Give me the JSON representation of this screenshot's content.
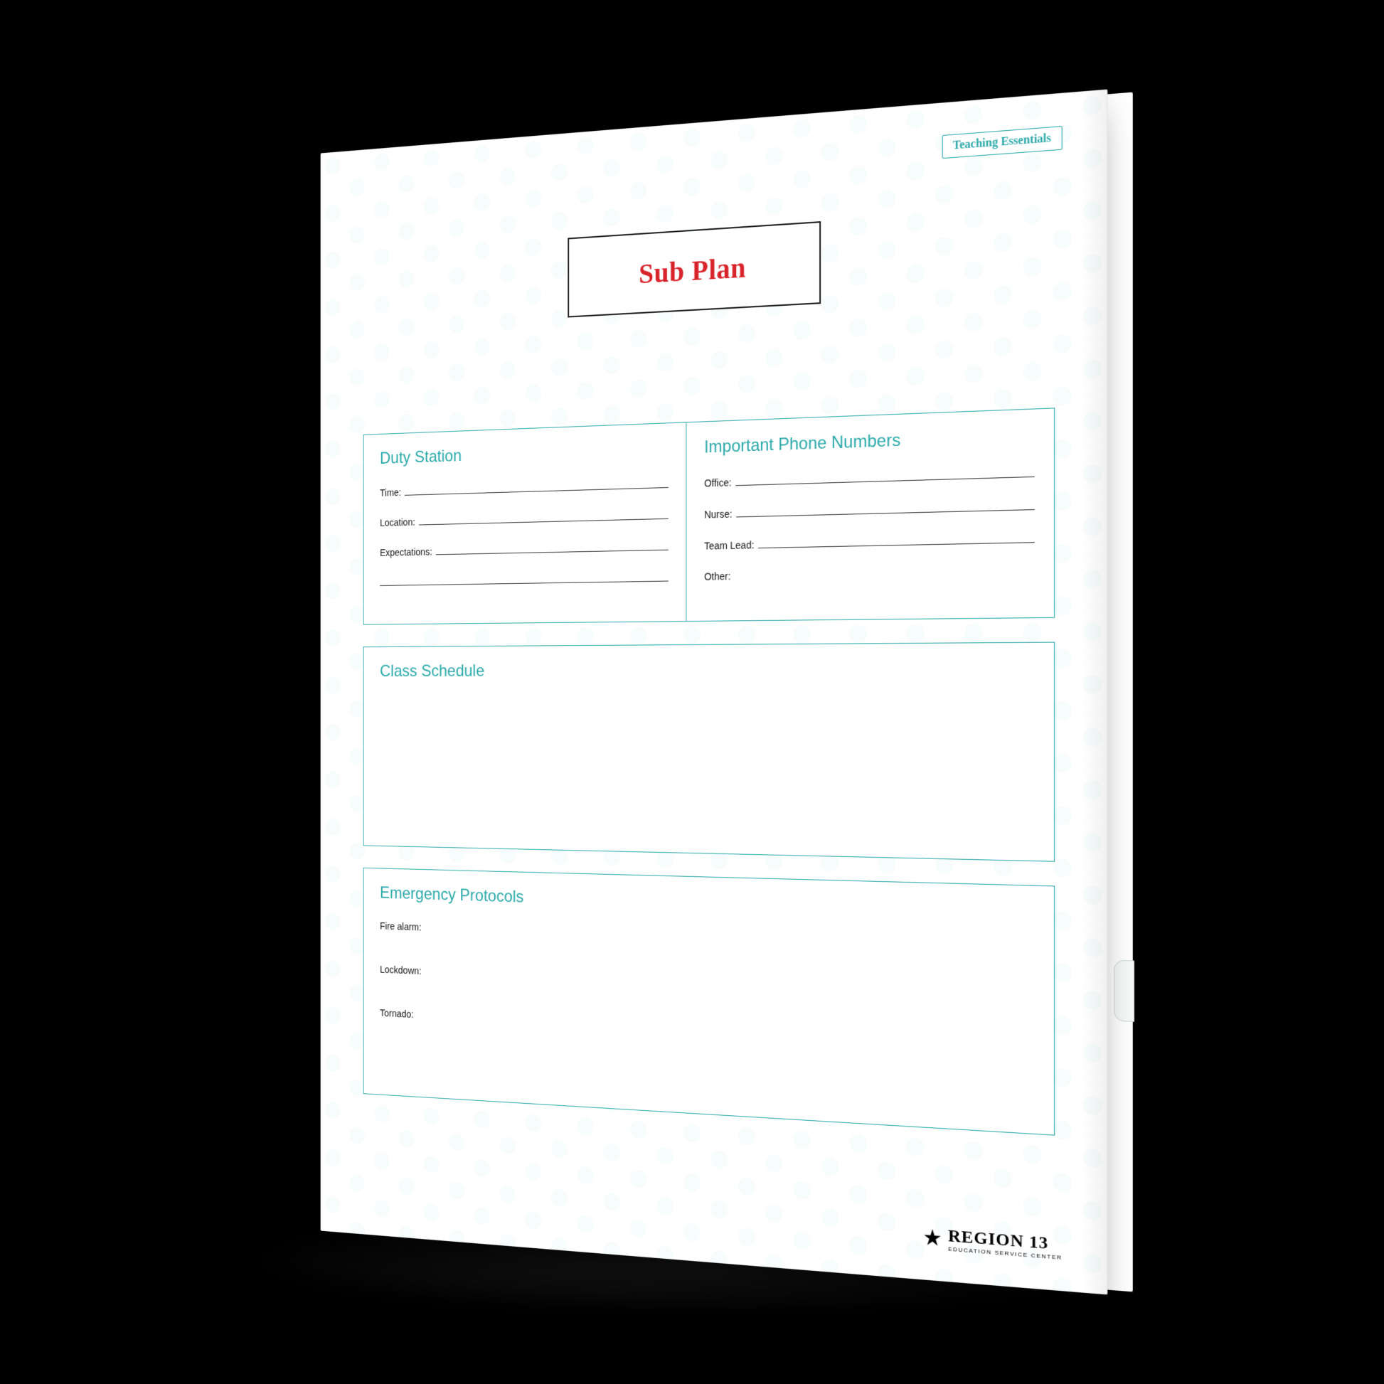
{
  "badge": "Teaching Essentials",
  "title": "Sub Plan",
  "duty_station": {
    "heading": "Duty Station",
    "fields": {
      "time": "Time:",
      "location": "Location:",
      "expectations": "Expectations:"
    }
  },
  "phone_numbers": {
    "heading": "Important Phone Numbers",
    "fields": {
      "office": "Office:",
      "nurse": "Nurse:",
      "team_lead": "Team Lead:",
      "other": "Other:"
    }
  },
  "class_schedule": {
    "heading": "Class Schedule"
  },
  "emergency": {
    "heading": "Emergency Protocols",
    "fields": {
      "fire": "Fire alarm:",
      "lockdown": "Lockdown:",
      "tornado": "Tornado:"
    }
  },
  "footer": {
    "brand": "REGION 13",
    "subtitle": "EDUCATION SERVICE CENTER"
  }
}
